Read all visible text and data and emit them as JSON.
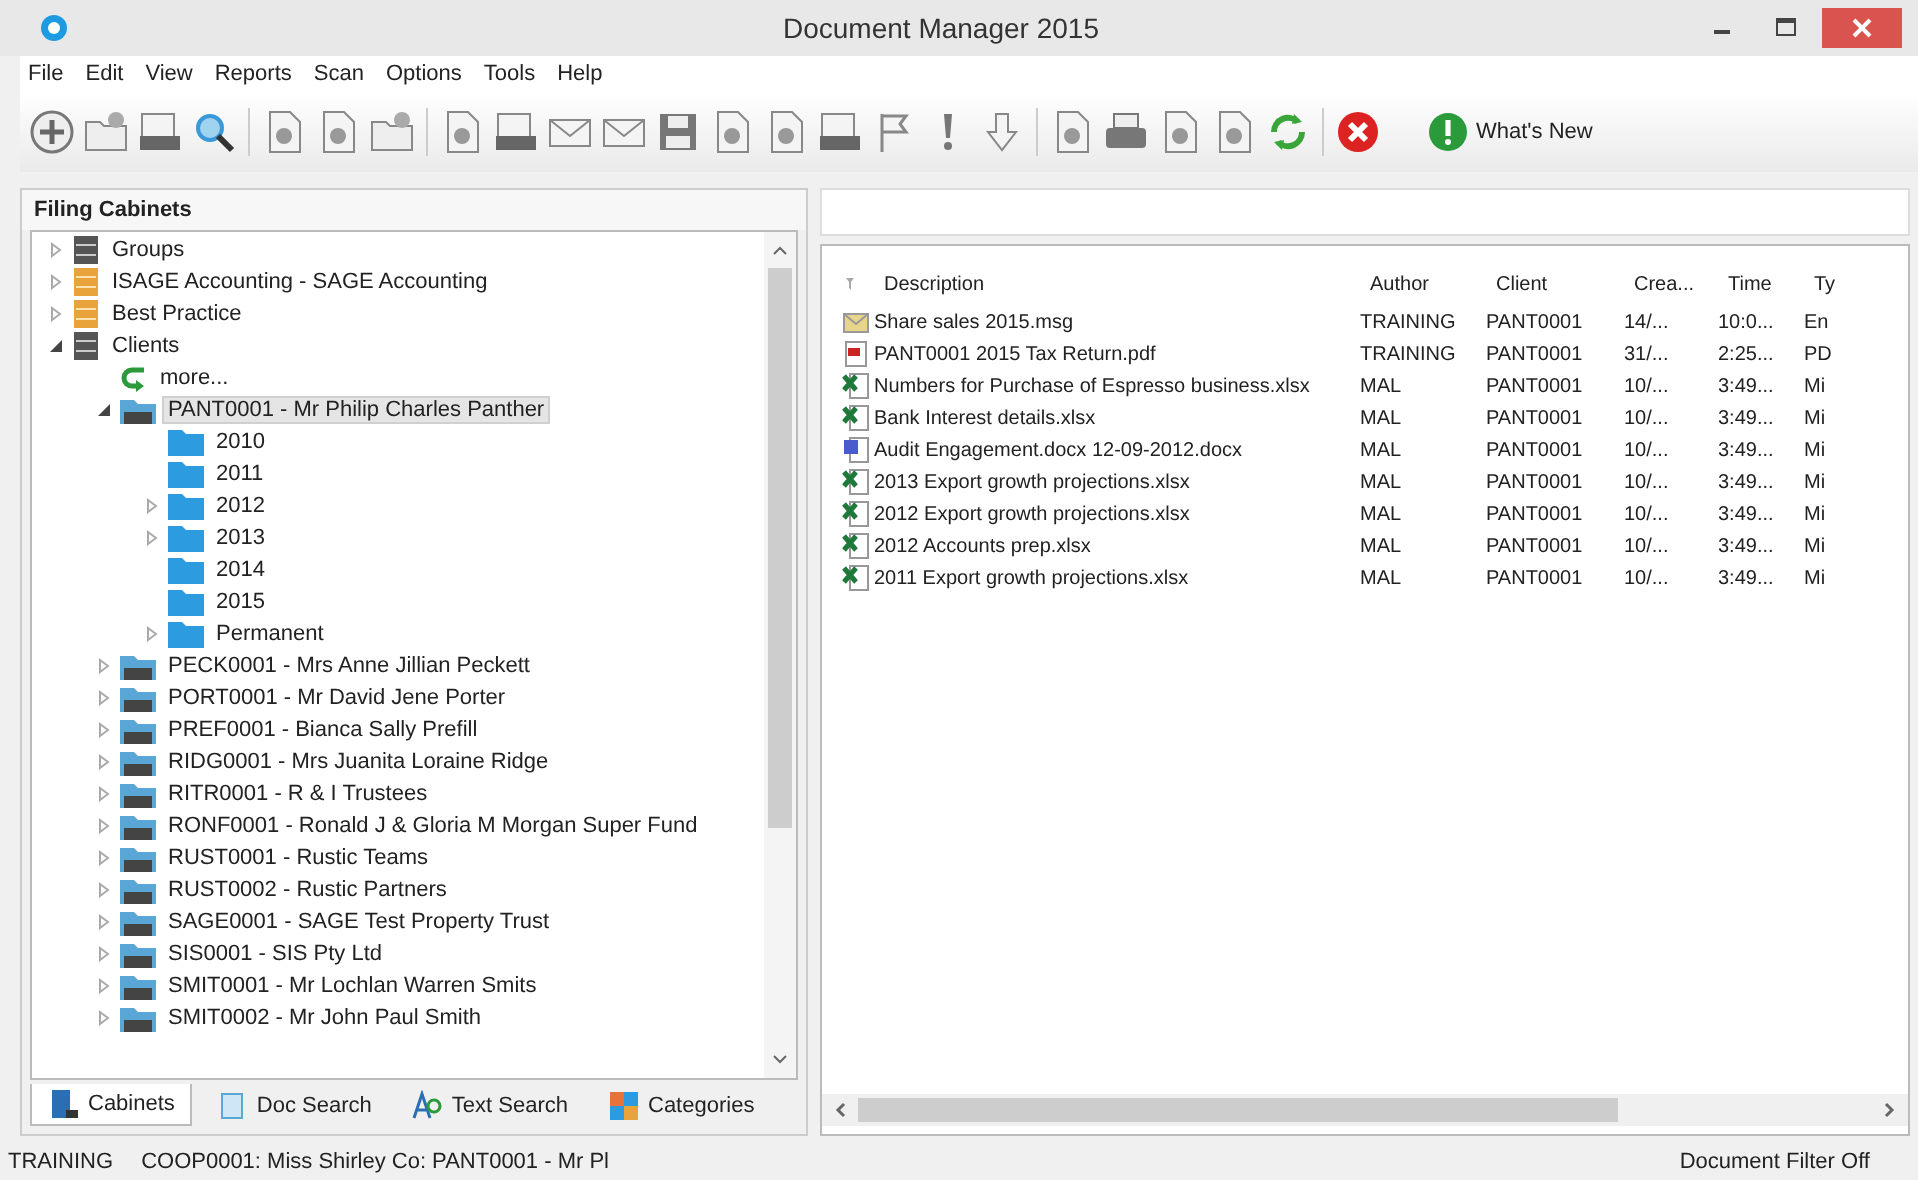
{
  "window": {
    "title": "Document Manager 2015"
  },
  "menu": [
    "File",
    "Edit",
    "View",
    "Reports",
    "Scan",
    "Options",
    "Tools",
    "Help"
  ],
  "toolbar": {
    "whats_new": "What's New"
  },
  "left_panel": {
    "title": "Filing Cabinets",
    "tree": [
      {
        "label": "Groups",
        "kind": "cabinet",
        "expanded": false,
        "selected": false
      },
      {
        "label": "ISAGE Accounting - SAGE Accounting",
        "kind": "cabinet_orange",
        "expanded": false,
        "selected": false
      },
      {
        "label": "Best Practice",
        "kind": "cabinet_orange",
        "expanded": false,
        "selected": false
      },
      {
        "label": "Clients",
        "kind": "cabinet",
        "expanded": true,
        "selected": false,
        "children": [
          {
            "label": "more...",
            "kind": "more",
            "selected": false
          },
          {
            "label": "PANT0001 - Mr Philip Charles Panther",
            "kind": "client",
            "expanded": true,
            "selected": true,
            "children": [
              {
                "label": "2010",
                "kind": "folder",
                "selected": false
              },
              {
                "label": "2011",
                "kind": "folder",
                "selected": false
              },
              {
                "label": "2012",
                "kind": "folder",
                "expanded": false,
                "selected": false
              },
              {
                "label": "2013",
                "kind": "folder",
                "expanded": false,
                "selected": false
              },
              {
                "label": "2014",
                "kind": "folder",
                "selected": false
              },
              {
                "label": "2015",
                "kind": "folder",
                "selected": false
              },
              {
                "label": "Permanent",
                "kind": "folder",
                "expanded": false,
                "selected": false
              }
            ]
          },
          {
            "label": "PECK0001 - Mrs Anne Jillian Peckett",
            "kind": "client",
            "expanded": false,
            "selected": false
          },
          {
            "label": "PORT0001 - Mr David Jene Porter",
            "kind": "client",
            "expanded": false,
            "selected": false
          },
          {
            "label": "PREF0001 - Bianca Sally Prefill",
            "kind": "client",
            "expanded": false,
            "selected": false
          },
          {
            "label": "RIDG0001 - Mrs Juanita Loraine Ridge",
            "kind": "client",
            "expanded": false,
            "selected": false
          },
          {
            "label": "RITR0001 - R & I Trustees",
            "kind": "client",
            "expanded": false,
            "selected": false
          },
          {
            "label": "RONF0001 - Ronald J & Gloria M Morgan Super Fund",
            "kind": "client",
            "expanded": false,
            "selected": false
          },
          {
            "label": "RUST0001 - Rustic Teams",
            "kind": "client",
            "expanded": false,
            "selected": false
          },
          {
            "label": "RUST0002 - Rustic Partners",
            "kind": "client",
            "expanded": false,
            "selected": false
          },
          {
            "label": "SAGE0001 - SAGE Test Property Trust",
            "kind": "client",
            "expanded": false,
            "selected": false
          },
          {
            "label": "SIS0001 - SIS Pty Ltd",
            "kind": "client",
            "expanded": false,
            "selected": false
          },
          {
            "label": "SMIT0001 - Mr Lochlan Warren Smits",
            "kind": "client",
            "expanded": false,
            "selected": false
          },
          {
            "label": "SMIT0002 - Mr John Paul Smith",
            "kind": "client",
            "expanded": false,
            "selected": false
          }
        ]
      }
    ],
    "tabs": [
      {
        "label": "Cabinets",
        "kind": "cabinets",
        "selected": true
      },
      {
        "label": "Doc Search",
        "kind": "doc",
        "selected": false
      },
      {
        "label": "Text Search",
        "kind": "text",
        "selected": false
      },
      {
        "label": "Categories",
        "kind": "categories",
        "selected": false
      }
    ]
  },
  "documents": {
    "columns": [
      "Description",
      "Author",
      "Client",
      "Crea...",
      "Time",
      "Ty"
    ],
    "rows": [
      {
        "kind": "msg",
        "cells": [
          "Share sales 2015.msg",
          "TRAINING",
          "PANT0001",
          "14/...",
          "10:0...",
          "En"
        ]
      },
      {
        "kind": "pdf",
        "cells": [
          "PANT0001 2015 Tax Return.pdf",
          "TRAINING",
          "PANT0001",
          "31/...",
          "2:25...",
          "PD"
        ]
      },
      {
        "kind": "xlsx",
        "cells": [
          "Numbers for Purchase of Espresso business.xlsx",
          "MAL",
          "PANT0001",
          "10/...",
          "3:49...",
          "Mi"
        ]
      },
      {
        "kind": "xlsx",
        "cells": [
          "Bank Interest details.xlsx",
          "MAL",
          "PANT0001",
          "10/...",
          "3:49...",
          "Mi"
        ]
      },
      {
        "kind": "docx",
        "cells": [
          "Audit Engagement.docx 12-09-2012.docx",
          "MAL",
          "PANT0001",
          "10/...",
          "3:49...",
          "Mi"
        ]
      },
      {
        "kind": "xlsx",
        "cells": [
          "2013 Export growth projections.xlsx",
          "MAL",
          "PANT0001",
          "10/...",
          "3:49...",
          "Mi"
        ]
      },
      {
        "kind": "xlsx",
        "cells": [
          "2012 Export growth projections.xlsx",
          "MAL",
          "PANT0001",
          "10/...",
          "3:49...",
          "Mi"
        ]
      },
      {
        "kind": "xlsx",
        "cells": [
          "2012 Accounts prep.xlsx",
          "MAL",
          "PANT0001",
          "10/...",
          "3:49...",
          "Mi"
        ]
      },
      {
        "kind": "xlsx",
        "cells": [
          "2011 Export growth projections.xlsx",
          "MAL",
          "PANT0001",
          "10/...",
          "3:49...",
          "Mi"
        ]
      }
    ]
  },
  "status_bar": [
    "TRAINING",
    "COOP0001: Miss Shirley Co: PANT0001 - Mr Pl",
    "Document Filter Off"
  ]
}
